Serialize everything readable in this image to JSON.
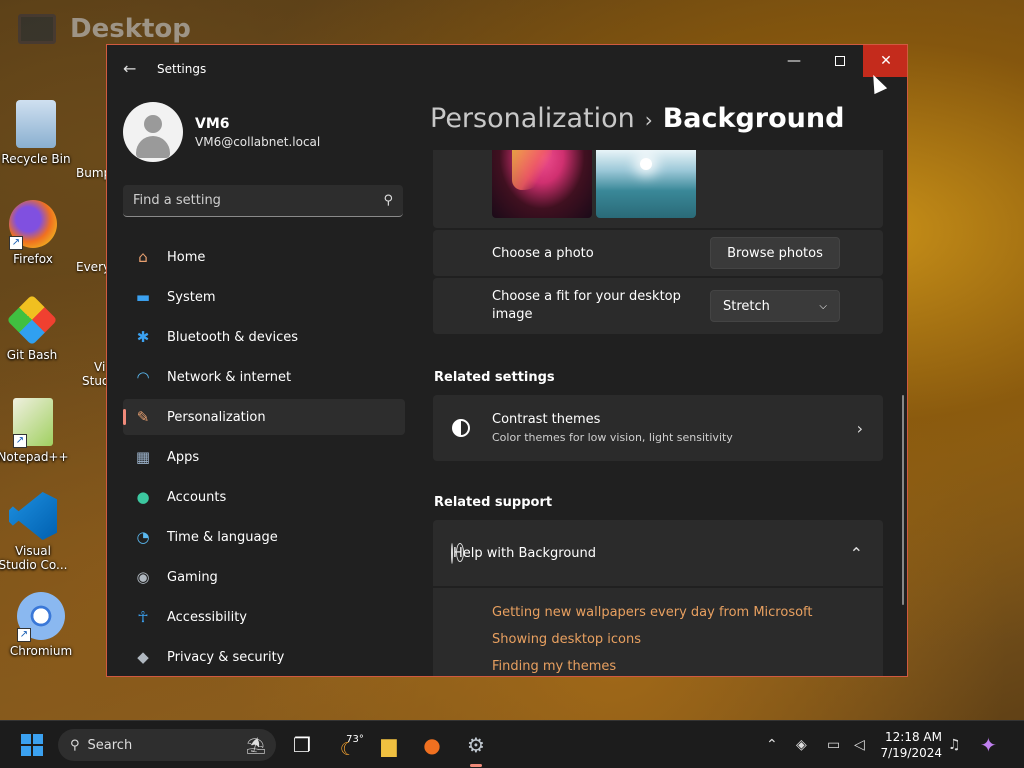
{
  "desktop": {
    "title": "Desktop",
    "icons": [
      {
        "label": "Recycle Bin",
        "icon": "recycle-bin-icon"
      },
      {
        "label": "Firefox",
        "icon": "firefox-icon"
      },
      {
        "label": "Git Bash",
        "icon": "git-bash-icon"
      },
      {
        "label": "Notepad++",
        "icon": "notepadpp-icon"
      },
      {
        "label": "Visual Studio Co...",
        "icon": "vscode-icon"
      },
      {
        "label": "Chromium",
        "icon": "chromium-icon"
      }
    ],
    "partial_icons": [
      "Bump",
      "Every",
      "Vi",
      "Stud"
    ]
  },
  "window": {
    "title": "Settings",
    "controls": {
      "minimize": "—",
      "maximize": "",
      "close": "✕"
    }
  },
  "profile": {
    "name": "VM6",
    "email": "VM6@collabnet.local"
  },
  "search": {
    "placeholder": "Find a setting"
  },
  "nav": {
    "items": [
      {
        "label": "Home",
        "icon": "home-icon",
        "glyph": "⌂",
        "color": "#e8a070"
      },
      {
        "label": "System",
        "icon": "system-icon",
        "glyph": "▬",
        "color": "#3ba1f0"
      },
      {
        "label": "Bluetooth & devices",
        "icon": "bluetooth-icon",
        "glyph": "✱",
        "color": "#3ba1f0"
      },
      {
        "label": "Network & internet",
        "icon": "wifi-icon",
        "glyph": "◠",
        "color": "#5ab8f0"
      },
      {
        "label": "Personalization",
        "icon": "brush-icon",
        "glyph": "✎",
        "color": "#e8a070"
      },
      {
        "label": "Apps",
        "icon": "apps-icon",
        "glyph": "▦",
        "color": "#9ab0c8"
      },
      {
        "label": "Accounts",
        "icon": "accounts-icon",
        "glyph": "●",
        "color": "#3cc8a0"
      },
      {
        "label": "Time & language",
        "icon": "time-language-icon",
        "glyph": "◔",
        "color": "#5ab8f0"
      },
      {
        "label": "Gaming",
        "icon": "gaming-icon",
        "glyph": "◉",
        "color": "#b0b8c0"
      },
      {
        "label": "Accessibility",
        "icon": "accessibility-icon",
        "glyph": "☥",
        "color": "#3ba1f0"
      },
      {
        "label": "Privacy & security",
        "icon": "shield-icon",
        "glyph": "◆",
        "color": "#b0b8c0"
      }
    ],
    "active": "Personalization"
  },
  "breadcrumb": {
    "parent": "Personalization",
    "separator": "›",
    "current": "Background"
  },
  "background": {
    "choose_photo_label": "Choose a photo",
    "browse_button": "Browse photos",
    "fit_label": "Choose a fit for your desktop image",
    "fit_value": "Stretch"
  },
  "related_settings": {
    "title": "Related settings",
    "contrast_title": "Contrast themes",
    "contrast_sub": "Color themes for low vision, light sensitivity"
  },
  "related_support": {
    "title": "Related support",
    "help_title": "Help with Background",
    "links": [
      "Getting new wallpapers every day from Microsoft",
      "Showing desktop icons",
      "Finding my themes"
    ]
  },
  "taskbar": {
    "search_label": "Search",
    "weather_temp": "73°",
    "time": "12:18 AM",
    "date": "7/19/2024"
  },
  "colors": {
    "accent": "#f08a7a",
    "link": "#e8a060",
    "close_hover": "#c42b1c"
  }
}
